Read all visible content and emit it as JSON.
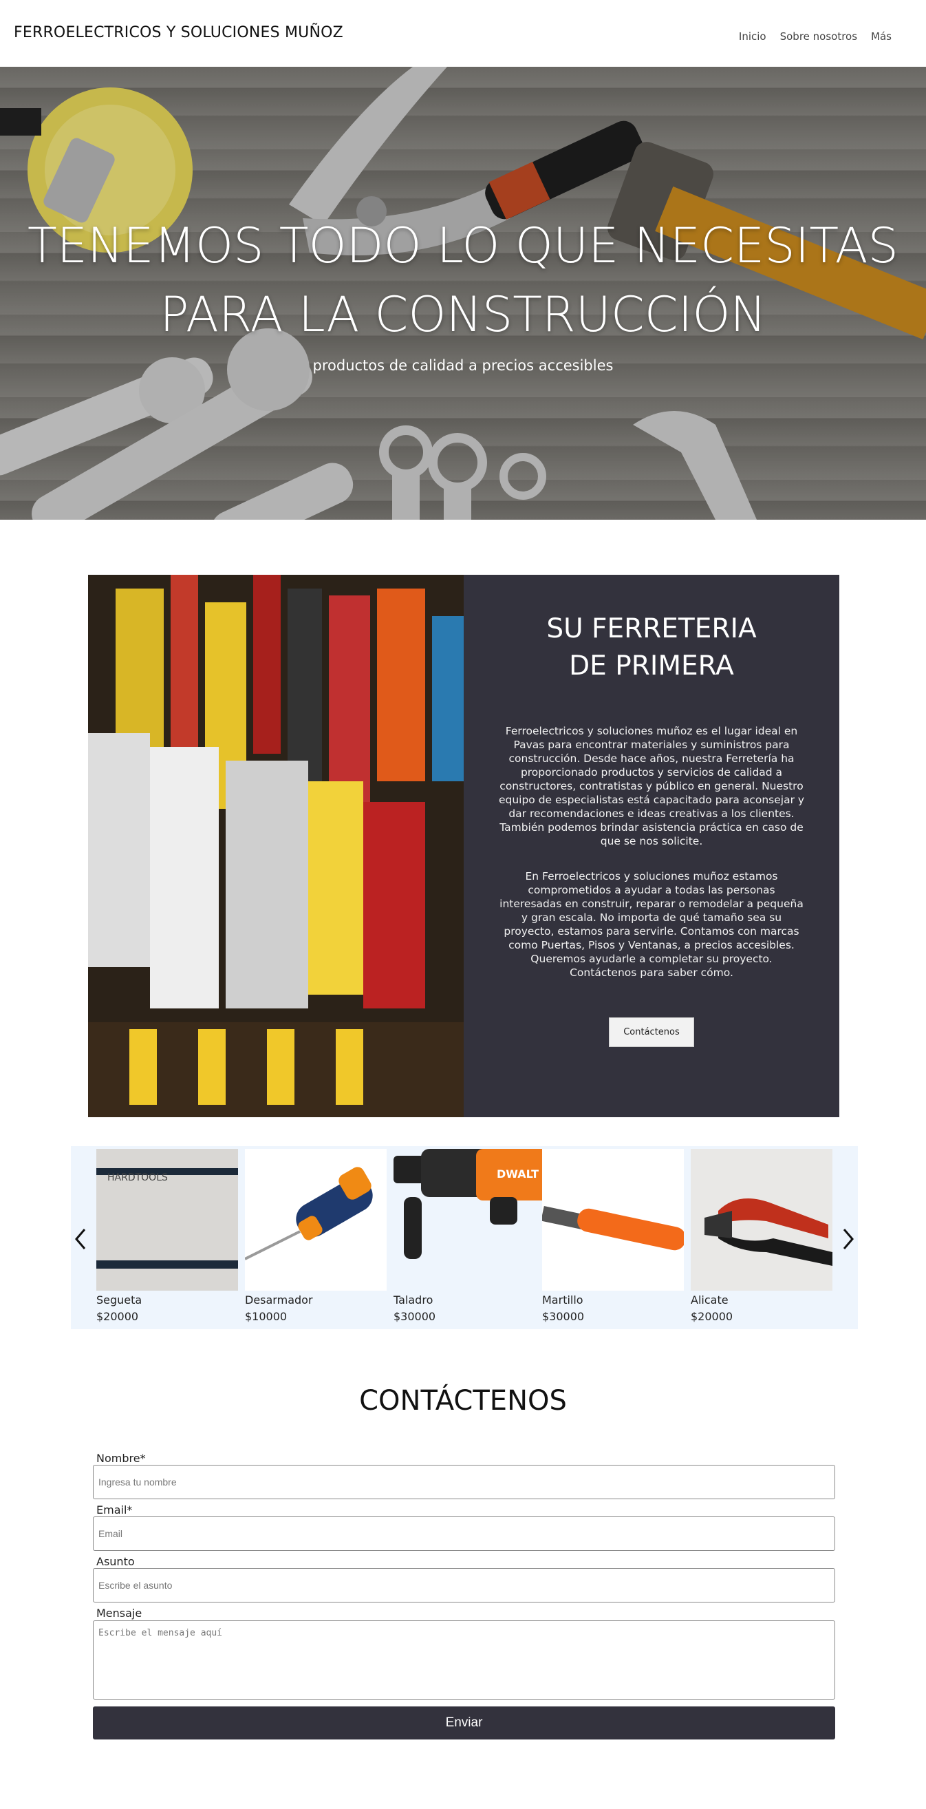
{
  "header": {
    "brand": "FERROELECTRICOS Y SOLUCIONES MUÑOZ",
    "nav": [
      "Inicio",
      "Sobre nosotros",
      "Más"
    ]
  },
  "hero": {
    "title_line1": "TENEMOS TODO LO QUE NECESITAS",
    "title_line2": "PARA LA CONSTRUCCIÓN",
    "subtitle": "productos de calidad a precios accesibles"
  },
  "about": {
    "title_line1": "SU FERRETERIA",
    "title_line2": "DE PRIMERA",
    "paragraph1": "Ferroelectricos y soluciones muñoz es el lugar ideal en Pavas para encontrar materiales y suministros para construcción. Desde hace años, nuestra Ferretería ha proporcionado productos y servicios de calidad a constructores, contratistas y público en general. Nuestro equipo de especialistas está capacitado para aconsejar y dar recomendaciones e ideas creativas a los clientes. También podemos brindar asistencia práctica en caso de que se nos solicite.",
    "paragraph2": "En Ferroelectricos y soluciones muñoz estamos comprometidos a ayudar a todas las personas interesadas en construir, reparar o remodelar a pequeña y gran escala. No importa de qué tamaño sea su proyecto, estamos para servirle. Contamos con marcas como Puertas, Pisos y Ventanas, a precios accesibles. Queremos ayudarle a completar su proyecto. Contáctenos para saber cómo.",
    "button_label": "Contáctenos"
  },
  "products": [
    {
      "name": "Segueta",
      "price": "$20000",
      "icon": "hacksaw-icon"
    },
    {
      "name": "Desarmador",
      "price": "$10000",
      "icon": "screwdriver-icon"
    },
    {
      "name": "Taladro",
      "price": "$30000",
      "icon": "drill-icon"
    },
    {
      "name": "Martillo",
      "price": "$30000",
      "icon": "hammer-icon"
    },
    {
      "name": "Alicate",
      "price": "$20000",
      "icon": "pliers-icon"
    }
  ],
  "contact": {
    "title": "CONTÁCTENOS",
    "name_label": "Nombre*",
    "name_placeholder": "Ingresa tu nombre",
    "email_label": "Email*",
    "email_placeholder": "Email",
    "subject_label": "Asunto",
    "subject_placeholder": "Escribe el asunto",
    "message_label": "Mensaje",
    "message_placeholder": "Escribe el mensaje aquí",
    "submit_label": "Enviar"
  },
  "colors": {
    "dark_panel": "#33323d",
    "carousel_bg": "#eef5fd",
    "drill_orange": "#f07a1a"
  }
}
